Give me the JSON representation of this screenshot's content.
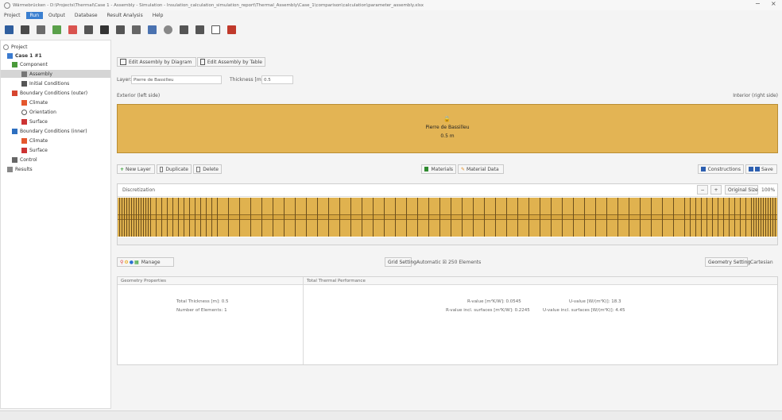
{
  "window": {
    "title": "Wärmebrücken - D:\\Projects\\Thermal\\Case 1 - Assembly - Simulation - Insulation_calculation_simulation_report\\Thermal_Assembly\\Case_1\\comparison\\calculation\\parameter_assembly.xlsx",
    "minimize": "−",
    "close": "×"
  },
  "menu": [
    "Project",
    "Run",
    "Output",
    "Database",
    "Result Analysis",
    "Help"
  ],
  "toolbar_icons": [
    "new-file-icon",
    "open-folder-icon",
    "save-icon",
    "import-icon",
    "delete-icon",
    "filter-icon",
    "funnel-icon",
    "table-icon",
    "chart-icon",
    "line-chart-icon",
    "clock-icon",
    "monitor-icon",
    "document-icon",
    "help-icon",
    "exit-icon"
  ],
  "tree": {
    "project": "Project",
    "case": "Case 1 #1",
    "component": "Component",
    "assembly": "Assembly",
    "initial": "Initial Conditions",
    "bc_outer": "Boundary Conditions (outer)",
    "climate1": "Climate",
    "orientation": "Orientation",
    "surface1": "Surface",
    "bc_inner": "Boundary Conditions (inner)",
    "climate2": "Climate",
    "surface2": "Surface",
    "control": "Control",
    "results": "Results"
  },
  "main": {
    "tab_diagram": "Edit Assembly by Diagram",
    "tab_table": "Edit Assembly by Table",
    "layer_label": "Layer:",
    "layer_value": "Pierre de Bassilleu",
    "thickness_label": "Thickness [m]:",
    "thickness_value": "0.5",
    "exterior_label": "Exterior (left side)",
    "interior_label": "Interior (right side)",
    "layer_name": "Pierre de Bassilleu",
    "layer_thickness": "0.5 m",
    "btn_new_layer": "New Layer",
    "btn_duplicate": "Duplicate",
    "btn_delete": "Delete",
    "btn_materials": "Materials",
    "btn_material_data": "Material Data",
    "btn_construction": "Constructions",
    "btn_save": "Save",
    "grid_title": "Discretization",
    "grid_zoom_out": "−",
    "grid_zoom_in": "+",
    "grid_original": "Original Size",
    "grid_zoom": "100%",
    "btn_manage": "Manage",
    "grid_setting": "Grid Setting",
    "automatic": "Automatic ☒ 250 Elements",
    "geometry_setting": "Geometry Setting",
    "geometry_value": "Cartesian",
    "geo_props_title": "Geometry Properties",
    "thermal_title": "Total Thermal Performance",
    "total_thickness": "Total Thickness [m]: 0.5",
    "number_elements": "Number of Elements: 1",
    "r_value": "R-value [m²K/W]: 0.0545",
    "u_value": "U-value [W/(m²K)]: 18.3",
    "r_value_surf": "R-value incl. surfaces [m²K/W]: 0.2245",
    "u_value_surf": "U-value incl. surfaces [W/(m²K)]: 4.45"
  },
  "colors": {
    "layer": "#e3b454",
    "accent": "#3a7fd0"
  }
}
